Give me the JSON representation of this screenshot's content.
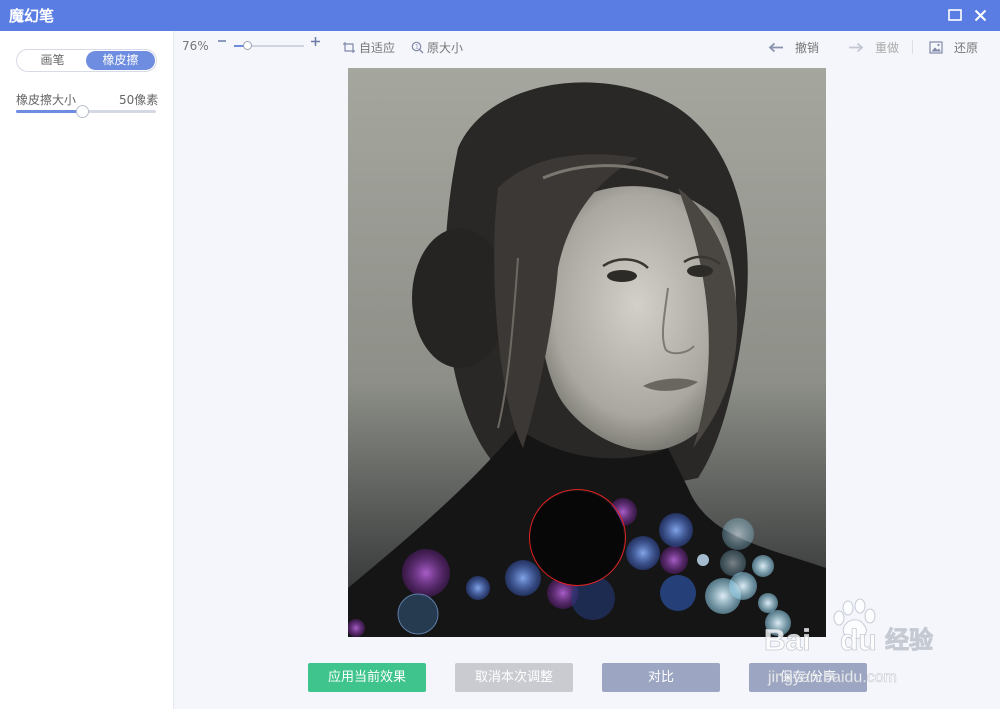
{
  "window": {
    "title": "魔幻笔"
  },
  "sidebar": {
    "tabs": [
      {
        "label": "画笔",
        "active": false
      },
      {
        "label": "橡皮擦",
        "active": true
      }
    ],
    "eraser_size_label": "橡皮擦大小",
    "eraser_size_value": "50像素",
    "eraser_size_fraction": 0.47
  },
  "toolbar": {
    "zoom_value": "76%",
    "zoom_fraction": 0.19,
    "fit_label": "自适应",
    "original_size_label": "原大小",
    "undo_label": "撤销",
    "redo_label": "重做",
    "restore_label": "还原"
  },
  "actions": {
    "apply_label": "应用当前效果",
    "cancel_label": "取消本次调整",
    "compare_label": "对比",
    "save_label": "保存/分享"
  },
  "watermark": {
    "brand": "Bai du 经验",
    "url": "jingyan.baidu.com"
  },
  "colors": {
    "accent": "#5a7de3",
    "apply": "#3ec48c",
    "brush_cursor": "#e02020"
  }
}
